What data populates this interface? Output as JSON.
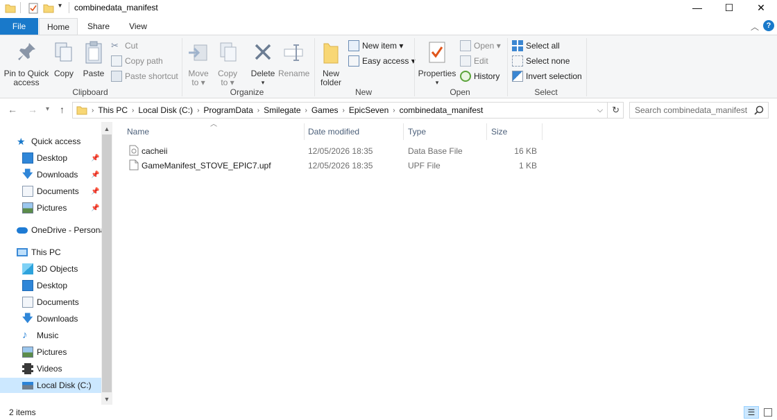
{
  "window": {
    "title": "combinedata_manifest",
    "minimize": "—",
    "maximize": "☐",
    "close": "✕"
  },
  "ribbon": {
    "tabs": {
      "file": "File",
      "home": "Home",
      "share": "Share",
      "view": "View"
    },
    "clipboard": {
      "label": "Clipboard",
      "pin_line1": "Pin to Quick",
      "pin_line2": "access",
      "copy": "Copy",
      "paste": "Paste",
      "cut": "Cut",
      "copy_path": "Copy path",
      "paste_shortcut": "Paste shortcut"
    },
    "organize": {
      "label": "Organize",
      "move_line1": "Move",
      "move_line2": "to ▾",
      "copy_line1": "Copy",
      "copy_line2": "to ▾",
      "delete_line1": "Delete",
      "delete_line2": "▾",
      "rename": "Rename"
    },
    "new": {
      "label": "New",
      "folder_line1": "New",
      "folder_line2": "folder",
      "new_item": "New item ▾",
      "easy_access": "Easy access ▾"
    },
    "open": {
      "label": "Open",
      "properties_line1": "Properties",
      "properties_line2": "▾",
      "open": "Open ▾",
      "edit": "Edit",
      "history": "History"
    },
    "select": {
      "label": "Select",
      "select_all": "Select all",
      "select_none": "Select none",
      "invert": "Invert selection"
    }
  },
  "address": {
    "crumbs": [
      "This PC",
      "Local Disk (C:)",
      "ProgramData",
      "Smilegate",
      "Games",
      "EpicSeven",
      "combinedata_manifest"
    ],
    "search_placeholder": "Search combinedata_manifest"
  },
  "navpane": {
    "quick_access": "Quick access",
    "qa_items": [
      "Desktop",
      "Downloads",
      "Documents",
      "Pictures"
    ],
    "onedrive": "OneDrive - Persona",
    "this_pc": "This PC",
    "pc_items": [
      "3D Objects",
      "Desktop",
      "Documents",
      "Downloads",
      "Music",
      "Pictures",
      "Videos",
      "Local Disk (C:)"
    ]
  },
  "filelist": {
    "columns": {
      "name": "Name",
      "date": "Date modified",
      "type": "Type",
      "size": "Size"
    },
    "rows": [
      {
        "name": "cacheii",
        "date": "12/05/2026 18:35",
        "type": "Data Base File",
        "size": "16 KB",
        "icon": "database-file-icon"
      },
      {
        "name": "GameManifest_STOVE_EPIC7.upf",
        "date": "12/05/2026 18:35",
        "type": "UPF File",
        "size": "1 KB",
        "icon": "blank-file-icon"
      }
    ]
  },
  "status": {
    "items": "2 items"
  },
  "colors": {
    "accent": "#1979ca",
    "selection": "#cce8ff",
    "folder": "#f8d775"
  }
}
